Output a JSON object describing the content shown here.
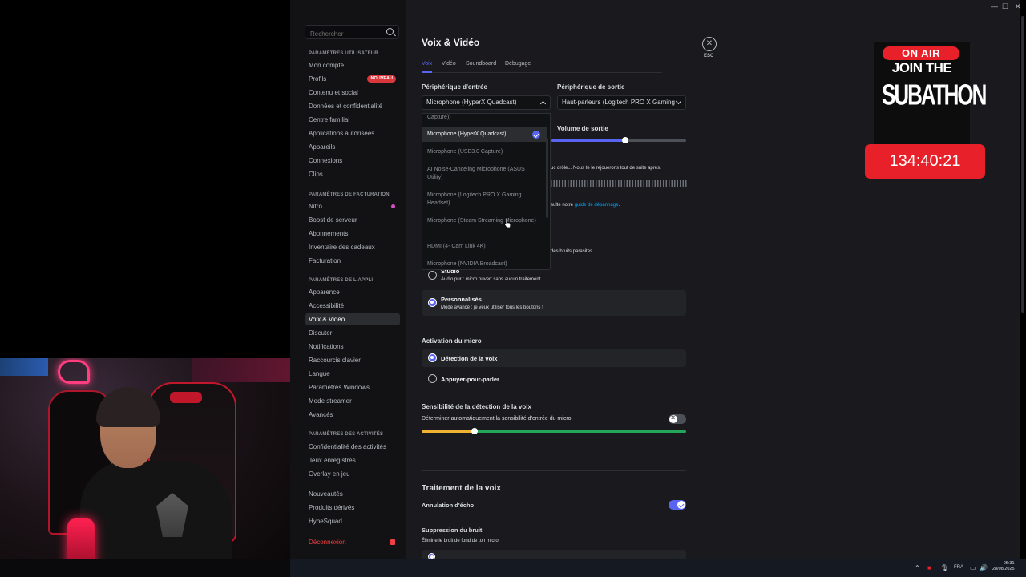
{
  "window": {
    "min": "—",
    "max": "☐",
    "close": "✕"
  },
  "search": {
    "placeholder": "Rechercher"
  },
  "sidebar": {
    "section_user": "Paramètres utilisateur",
    "user_items": [
      "Mon compte",
      "Profils",
      "Contenu et social",
      "Données et confidentialité",
      "Centre familial",
      "Applications autorisées",
      "Appareils",
      "Connexions",
      "Clips"
    ],
    "profils_badge": "NOUVEAU",
    "section_billing": "Paramètres de facturation",
    "billing_items": [
      "Nitro",
      "Boost de serveur",
      "Abonnements",
      "Inventaire des cadeaux",
      "Facturation"
    ],
    "section_app": "Paramètres de l'appli",
    "app_items": [
      "Apparence",
      "Accessibilité",
      "Voix & Vidéo",
      "Discuter",
      "Notifications",
      "Raccourcis clavier",
      "Langue",
      "Paramètres Windows",
      "Mode streamer",
      "Avancés"
    ],
    "section_activity": "Paramètres des activités",
    "activity_items": [
      "Confidentialité des activités",
      "Jeux enregistrés",
      "Overlay en jeu"
    ],
    "misc_items": [
      "Nouveautés",
      "Produits dérivés",
      "HypeSquad"
    ],
    "logout": "Déconnexion"
  },
  "page": {
    "title": "Voix & Vidéo",
    "tabs": [
      "Voix",
      "Vidéo",
      "Soundboard",
      "Débugage"
    ],
    "close_label": "ESC",
    "input_label": "Périphérique d'entrée",
    "input_value": "Microphone (HyperX Quadcast)",
    "output_label": "Périphérique de sortie",
    "output_value": "Haut-parleurs (Logitech PRO X Gaming",
    "output_volume_label": "Volume de sortie",
    "output_volume": 0.55,
    "dropdown_items": [
      "Capture))",
      "Microphone (HyperX Quadcast)",
      "Microphone (USB3.0 Capture)",
      "AI Noise-Canceling Microphone (ASUS Utility)",
      "Microphone (Logitech PRO X Gaming Headset)",
      "Microphone (Steam Streaming Microphone)",
      "HDMI (4- Cam Link 4K)",
      "Microphone (NVIDIA Broadcast)"
    ],
    "mic_test_text": "uc drôle... Nous te le rejouerons tout de suite après.",
    "help_text_prefix": "sulte notre",
    "help_link": "guide de dépannage",
    "help_text_suffix": ".",
    "noise_text": "des bruits parasites",
    "profiles": [
      {
        "title": "Studio",
        "desc": "Audio pur : micro ouvert sans aucun traitement",
        "selected": false
      },
      {
        "title": "Personnalisés",
        "desc": "Mode avancé : je veux utiliser tous les boutons !",
        "selected": true
      }
    ],
    "activation_label": "Activation du micro",
    "activation_options": [
      {
        "title": "Détection de la voix",
        "selected": true
      },
      {
        "title": "Appuyer-pour-parler",
        "selected": false
      }
    ],
    "sensitivity_label": "Sensibilité de la détection de la voix",
    "sensitivity_auto_label": "Déterminer automatiquement la sensibilité d'entrée du micro",
    "sensitivity_auto": false,
    "sensitivity_value": 0.2,
    "processing_title": "Traitement de la voix",
    "echo_label": "Annulation d'écho",
    "echo_enabled": true,
    "noise_suppression_label": "Suppression du bruit",
    "noise_suppression_desc": "Élimine le bruit de fond de ton micro."
  },
  "overlay": {
    "on_air": "ON AIR",
    "join": "JOIN THE",
    "subathon": "SUBATHON",
    "timer": "134:40:21"
  },
  "taskbar": {
    "lang": "FRA",
    "time": "05:31",
    "date": "28/08/2025"
  },
  "colors": {
    "accent": "#5865f2",
    "danger": "#da373c",
    "onair": "#e8202a"
  }
}
